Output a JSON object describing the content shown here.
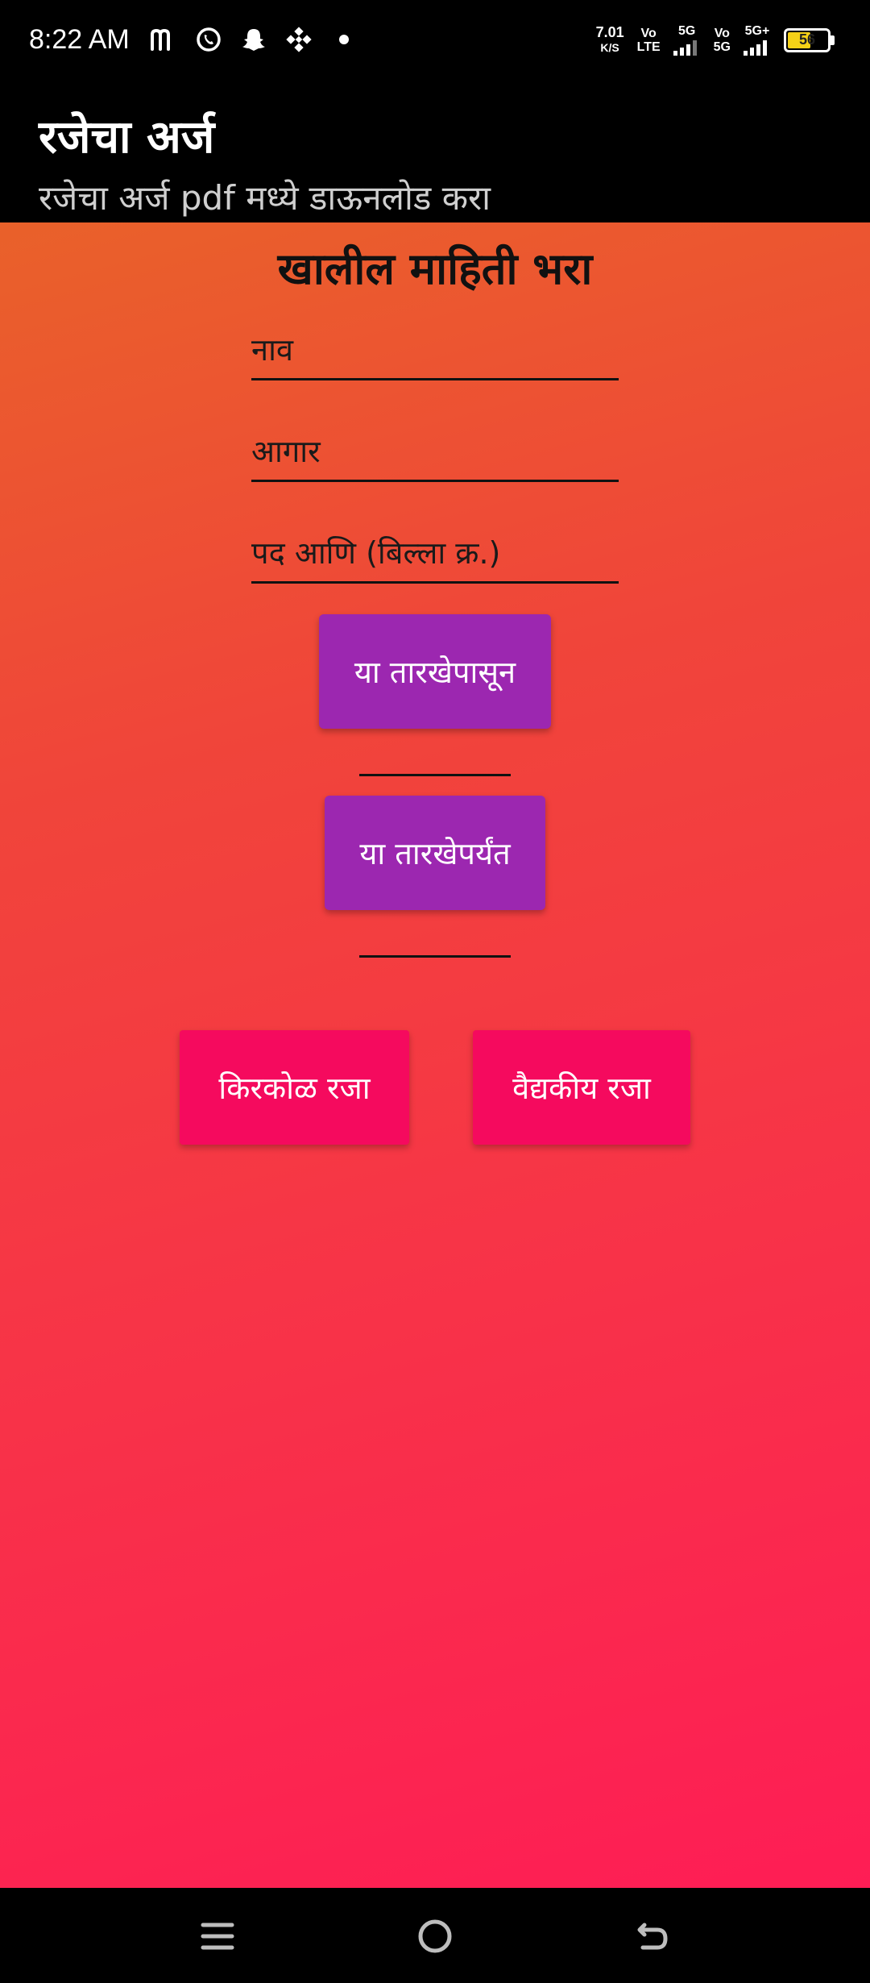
{
  "status_bar": {
    "time": "8:22 AM",
    "net_speed_value": "7.01",
    "net_speed_unit": "K/S",
    "sim1_label_top": "Vo",
    "sim1_label_bottom": "LTE",
    "sim1_net": "5G",
    "sim2_label_top": "Vo",
    "sim2_label_bottom": "5G",
    "sim2_net": "5G+",
    "battery_level": "56",
    "battery_color": "#f5d117",
    "notification_icons": [
      "m-icon",
      "whatsapp-icon",
      "snapchat-icon",
      "binance-icon",
      "dot-icon"
    ]
  },
  "app_bar": {
    "title": "रजेचा अर्ज",
    "subtitle": "रजेचा अर्ज pdf मध्ये डाऊनलोड करा"
  },
  "form": {
    "heading": "खालील माहिती भरा",
    "name_placeholder": "नाव",
    "depot_placeholder": "आगार",
    "post_placeholder": "पद आणि (बिल्ला क्र.)",
    "from_date_label": "या तारखेपासून",
    "from_date_value": "",
    "to_date_label": "या तारखेपर्यंत",
    "to_date_value": "",
    "casual_leave_label": "किरकोळ रजा",
    "medical_leave_label": "वैद्यकीय रजा"
  },
  "colors": {
    "date_button": "#9c27b0",
    "leave_button": "#f50a5e",
    "gradient_start": "#e9612a",
    "gradient_end": "#fe1d55"
  },
  "nav_bar": {
    "icons": [
      "menu-icon",
      "home-icon",
      "back-icon"
    ]
  }
}
